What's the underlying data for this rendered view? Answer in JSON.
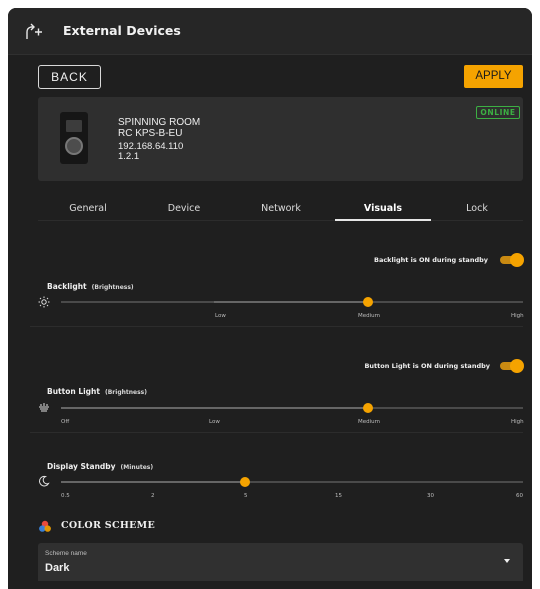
{
  "header": {
    "title": "External Devices",
    "icon": "device-link-icon"
  },
  "toolbar": {
    "back_label": "BACK",
    "apply_label": "APPLY"
  },
  "device": {
    "room": "SPINNING ROOM",
    "model": "RC KPS-B-EU",
    "ip": "192.168.64.110",
    "version": "1.2.1",
    "status": "ONLINE",
    "status_color": "#3cb043"
  },
  "tabs": [
    {
      "label": "General",
      "active": false
    },
    {
      "label": "Device",
      "active": false
    },
    {
      "label": "Network",
      "active": false
    },
    {
      "label": "Visuals",
      "active": true
    },
    {
      "label": "Lock",
      "active": false
    }
  ],
  "backlight": {
    "standby_label": "Backlight is ON during standby",
    "standby_on": true,
    "title": "Backlight",
    "subtitle": "(Brightness)",
    "ticks": [
      "Low",
      "Medium",
      "High"
    ],
    "value": "Medium",
    "icon": "brightness-icon"
  },
  "button_light": {
    "standby_label": "Button Light is ON during standby",
    "standby_on": true,
    "title": "Button Light",
    "subtitle": "(Brightness)",
    "ticks": [
      "Off",
      "Low",
      "Medium",
      "High"
    ],
    "value": "Medium",
    "icon": "button-light-icon"
  },
  "display_standby": {
    "title": "Display Standby",
    "subtitle": "(Minutes)",
    "ticks": [
      "0.5",
      "2",
      "5",
      "15",
      "30",
      "60"
    ],
    "value": "5",
    "icon": "moon-icon"
  },
  "color_scheme": {
    "title": "COLOR SCHEME",
    "icon": "palette-icon",
    "field_label": "Scheme name",
    "field_value": "Dark"
  },
  "colors": {
    "accent": "#f5a300",
    "background": "#1f1f1f",
    "online": "#3cb043"
  }
}
